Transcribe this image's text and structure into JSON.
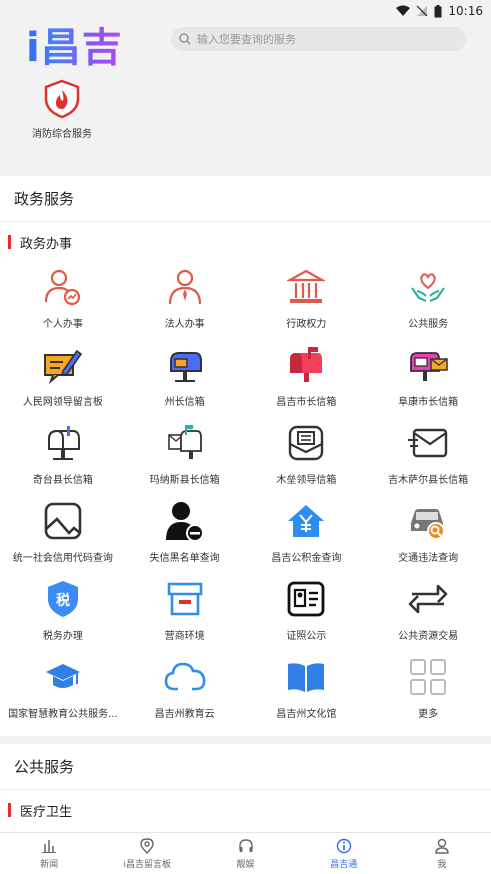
{
  "status": {
    "time": "10:16"
  },
  "header": {
    "logo": "i昌吉",
    "search_placeholder": "输入您要查询的服务"
  },
  "quick": {
    "fire_label": "消防综合服务"
  },
  "section1": {
    "title": "政务服务",
    "sub_title": "政务办事"
  },
  "items": [
    {
      "label": "个人办事",
      "icon": "person-chart-icon"
    },
    {
      "label": "法人办事",
      "icon": "person-tie-icon"
    },
    {
      "label": "行政权力",
      "icon": "government-building-icon"
    },
    {
      "label": "公共服务",
      "icon": "heart-hands-icon"
    },
    {
      "label": "人民网领导留言板",
      "icon": "message-pen-icon"
    },
    {
      "label": "州长信箱",
      "icon": "mailbox-icon"
    },
    {
      "label": "昌吉市长信箱",
      "icon": "mailbox-red-icon"
    },
    {
      "label": "阜康市长信箱",
      "icon": "mailbox-pink-icon"
    },
    {
      "label": "奇台县长信箱",
      "icon": "mailbox-outline-icon"
    },
    {
      "label": "玛纳斯县长信箱",
      "icon": "mailbox-flag-icon"
    },
    {
      "label": "木垒领导信箱",
      "icon": "envelope-open-icon"
    },
    {
      "label": "吉木萨尔县长信箱",
      "icon": "envelope-fast-icon"
    },
    {
      "label": "统一社会信用代码查询",
      "icon": "image-frame-icon"
    },
    {
      "label": "失信黑名单查询",
      "icon": "user-minus-icon"
    },
    {
      "label": "昌吉公积金查询",
      "icon": "house-yuan-icon"
    },
    {
      "label": "交通违法查询",
      "icon": "car-search-icon"
    },
    {
      "label": "税务办理",
      "icon": "tax-shield-icon"
    },
    {
      "label": "营商环境",
      "icon": "shop-icon"
    },
    {
      "label": "证照公示",
      "icon": "id-card-icon"
    },
    {
      "label": "公共资源交易",
      "icon": "exchange-icon"
    },
    {
      "label": "国家智慧教育公共服务...",
      "icon": "graduation-cap-icon"
    },
    {
      "label": "昌吉州教育云",
      "icon": "cloud-icon"
    },
    {
      "label": "昌吉州文化馆",
      "icon": "open-book-icon"
    },
    {
      "label": "更多",
      "icon": "more-grid-icon"
    }
  ],
  "section2": {
    "title": "公共服务",
    "sub_title": "医疗卫生"
  },
  "tabs": [
    {
      "label": "新闻",
      "icon": "bar-chart-icon"
    },
    {
      "label": "i昌吉留言板",
      "icon": "location-pin-icon"
    },
    {
      "label": "靓娱",
      "icon": "headphones-icon"
    },
    {
      "label": "昌吉通",
      "icon": "info-circle-icon",
      "active": true
    },
    {
      "label": "我",
      "icon": "person-icon"
    }
  ],
  "colors": {
    "accent": "#2f6cf5",
    "red": "#e0312d"
  }
}
